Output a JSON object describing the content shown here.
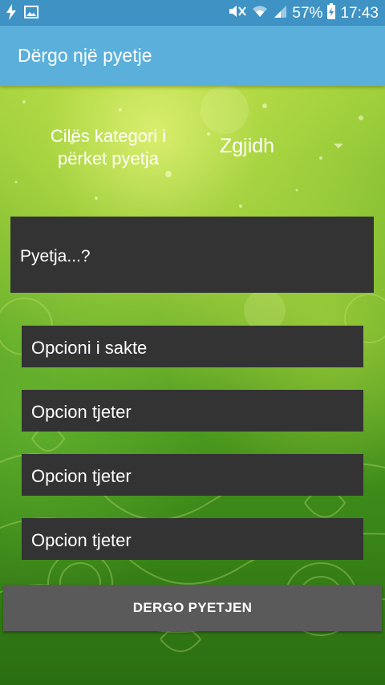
{
  "status_bar": {
    "battery_percent": "57%",
    "time": "17:43"
  },
  "app_bar": {
    "title": "Dërgo një pyetje"
  },
  "category": {
    "label": "Cilës kategori i përket pyetja",
    "selected": "Zgjidh"
  },
  "question": {
    "placeholder": "Pyetja...?"
  },
  "options": [
    {
      "placeholder": "Opcioni i sakte"
    },
    {
      "placeholder": "Opcion tjeter"
    },
    {
      "placeholder": "Opcion tjeter"
    },
    {
      "placeholder": "Opcion tjeter"
    }
  ],
  "submit": {
    "label": "DERGO PYETJEN"
  },
  "colors": {
    "status_bar": "#3f93c4",
    "app_bar": "#5ab0db",
    "field_bg": "#333333",
    "button_bg": "#5a5a5a"
  },
  "icons": [
    "flash-icon",
    "image-icon",
    "mute-icon",
    "wifi-icon",
    "signal-icon",
    "battery-icon",
    "spinner-arrow-icon"
  ]
}
